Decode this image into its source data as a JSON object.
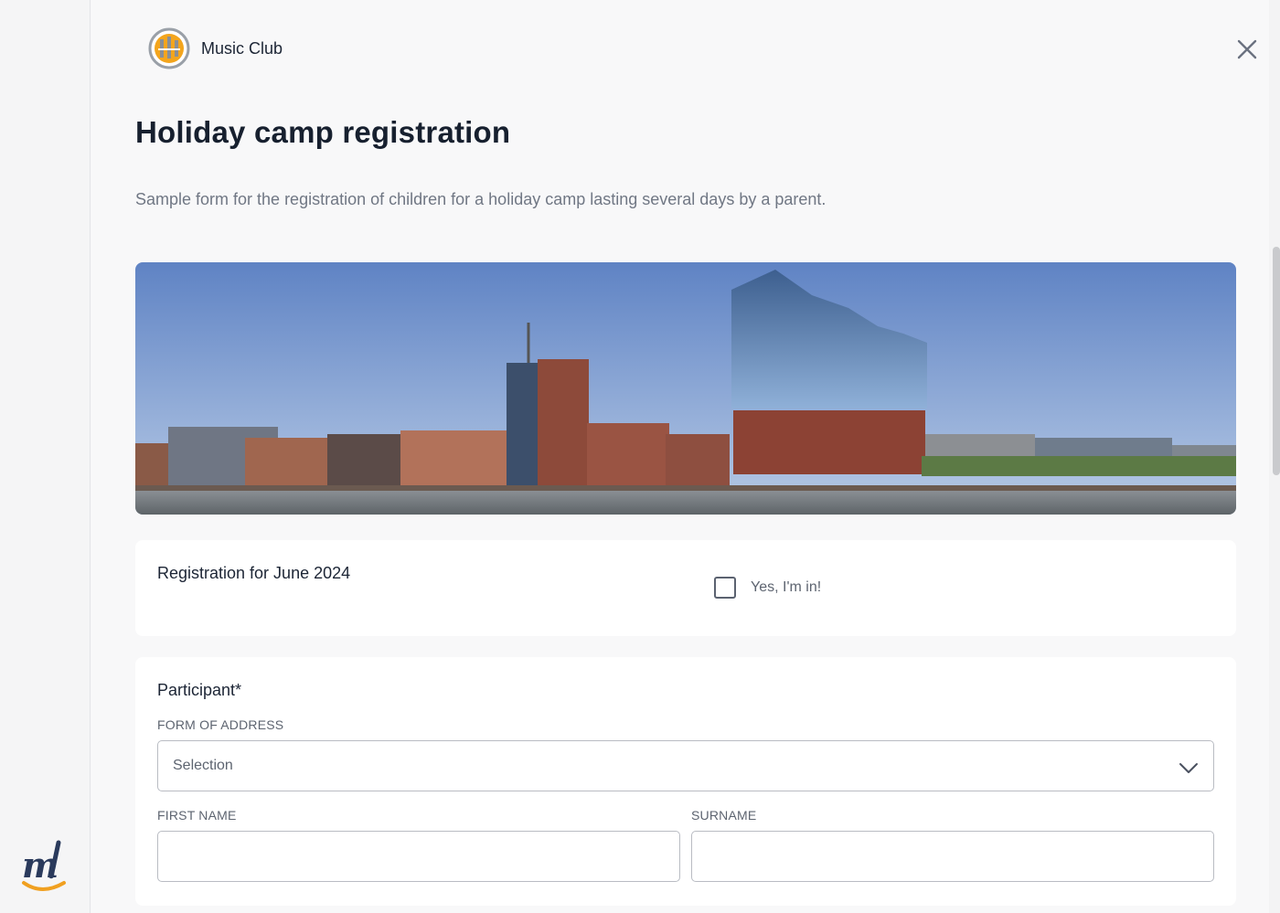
{
  "club": {
    "name": "Music Club",
    "logo_icon": "music-club-logo-icon"
  },
  "page": {
    "title": "Holiday camp registration",
    "description": "Sample form for the registration of children for a holiday camp lasting several days by a parent."
  },
  "hero": {
    "alt": "harbour-skyline-image"
  },
  "registration": {
    "label": "Registration for June 2024",
    "checkbox_label": "Yes, I'm in!",
    "checked": false
  },
  "participant": {
    "label": "Participant*",
    "form_of_address_label": "FORM OF ADDRESS",
    "form_of_address_value": "Selection",
    "first_name_label": "FIRST NAME",
    "first_name_value": "",
    "surname_label": "SURNAME",
    "surname_value": ""
  },
  "colors": {
    "accent": "#f0a020",
    "text": "#17202f",
    "muted": "#707784",
    "border": "#b9bcc3"
  },
  "icons": {
    "close": "close-icon",
    "chevron": "chevron-down-icon",
    "app": "app-logo-icon"
  }
}
